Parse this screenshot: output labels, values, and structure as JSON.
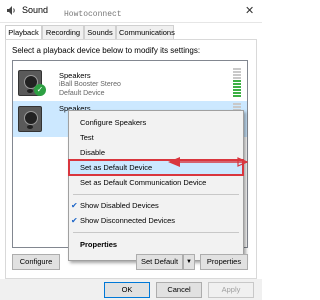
{
  "window": {
    "title": "Sound",
    "watermark": "Howtoconnect",
    "close_glyph": "✕"
  },
  "tabs": [
    {
      "label": "Playback",
      "active": true
    },
    {
      "label": "Recording",
      "active": false
    },
    {
      "label": "Sounds",
      "active": false
    },
    {
      "label": "Communications",
      "active": false
    }
  ],
  "instruction": "Select a playback device below to modify its settings:",
  "devices": [
    {
      "name": "Speakers",
      "line1": "iBall Booster Stereo",
      "line2": "Default Device",
      "is_default": true,
      "selected": false
    },
    {
      "name": "Speakers",
      "line1": "",
      "line2": "",
      "is_default": false,
      "selected": true
    }
  ],
  "context_menu": {
    "items": [
      {
        "label": "Configure Speakers"
      },
      {
        "label": "Test"
      },
      {
        "label": "Disable"
      },
      {
        "label": "Set as Default Device",
        "highlighted": true
      },
      {
        "label": "Set as Default Communication Device"
      },
      {
        "label": "Show Disabled Devices",
        "checked": true
      },
      {
        "label": "Show Disconnected Devices",
        "checked": true
      },
      {
        "label": "Properties",
        "bold": true
      }
    ]
  },
  "buttons": {
    "configure": "Configure",
    "set_default": "Set Default",
    "set_default_arrow": "▼",
    "properties": "Properties",
    "ok": "OK",
    "cancel": "Cancel",
    "apply": "Apply"
  },
  "colors": {
    "highlight": "#cce8ff",
    "annotation_red": "#d9363e",
    "default_check": "#2ea043"
  }
}
